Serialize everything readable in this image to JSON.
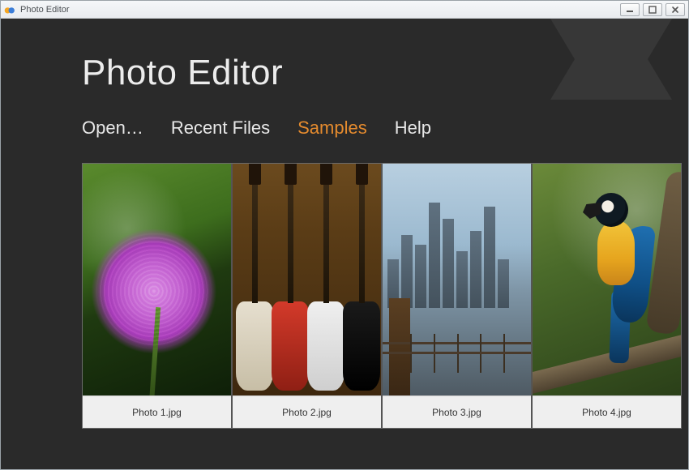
{
  "window": {
    "title": "Photo Editor"
  },
  "app": {
    "heading": "Photo Editor"
  },
  "tabs": {
    "open": "Open…",
    "recent": "Recent Files",
    "samples": "Samples",
    "help": "Help",
    "active": "samples"
  },
  "samples": [
    {
      "filename": "Photo 1.jpg",
      "subject": "purple-allium-flower"
    },
    {
      "filename": "Photo 2.jpg",
      "subject": "electric-guitars"
    },
    {
      "filename": "Photo 3.jpg",
      "subject": "city-skyline-bridge"
    },
    {
      "filename": "Photo 4.jpg",
      "subject": "blue-gold-macaw-parrot"
    }
  ],
  "colors": {
    "background": "#2a2a2a",
    "text": "#e8e8e8",
    "accent": "#e58b2e"
  }
}
